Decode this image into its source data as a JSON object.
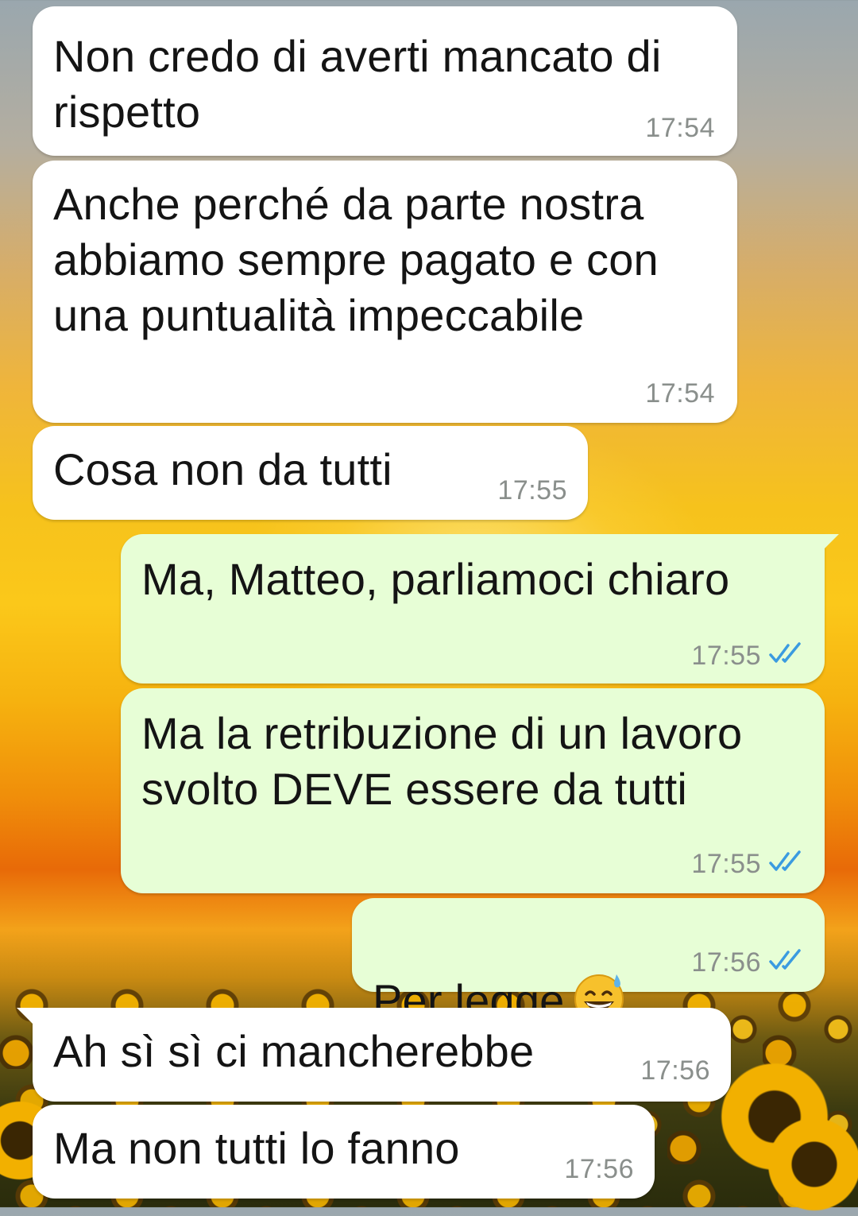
{
  "colors": {
    "incoming_bubble": "#ffffff",
    "outgoing_bubble": "#e7fed6",
    "read_tick": "#3b9be0",
    "timestamp": "#8a8f8c"
  },
  "messages": [
    {
      "direction": "incoming",
      "text": "Non credo di averti mancato di\nrispetto",
      "time": "17:54"
    },
    {
      "direction": "incoming",
      "text": "Anche perché da parte nostra\nabbiamo sempre pagato e con\nuna puntualità impeccabile",
      "time": "17:54"
    },
    {
      "direction": "incoming",
      "text": "Cosa non da tutti",
      "time": "17:55"
    },
    {
      "direction": "outgoing",
      "text": "Ma, Matteo, parliamoci chiaro",
      "time": "17:55",
      "status": "read-double-check-icon"
    },
    {
      "direction": "outgoing",
      "text": "Ma la retribuzione di un lavoro\nsvolto DEVE essere da tutti",
      "time": "17:55",
      "status": "read-double-check-icon"
    },
    {
      "direction": "outgoing",
      "text": "Per legge",
      "emoji": "grinning-face-with-sweat-emoji",
      "time": "17:56",
      "status": "read-double-check-icon"
    },
    {
      "direction": "incoming",
      "text": "Ah sì sì ci mancherebbe",
      "time": "17:56"
    },
    {
      "direction": "incoming",
      "text": "Ma non tutti lo fanno",
      "time": "17:56"
    }
  ]
}
